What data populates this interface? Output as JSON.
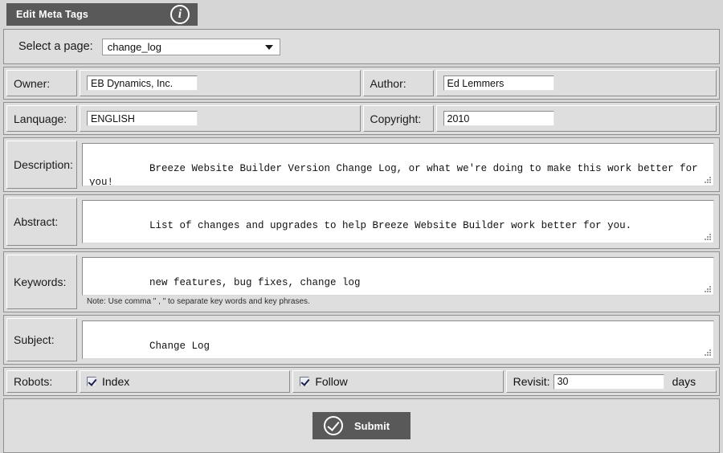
{
  "window": {
    "title": "Edit Meta Tags",
    "info_icon": "info-circle-icon"
  },
  "page_select": {
    "label": "Select a page:",
    "value": "change_log",
    "options": [
      "change_log"
    ]
  },
  "fields": {
    "owner": {
      "label": "Owner:",
      "value": "EB Dynamics, Inc."
    },
    "author": {
      "label": "Author:",
      "value": "Ed Lemmers"
    },
    "language": {
      "label": "Lanquage:",
      "value": "ENGLISH"
    },
    "copyright": {
      "label": "Copyright:",
      "value": "2010"
    },
    "description": {
      "label": "Description:",
      "value": "Breeze Website Builder Version Change Log, or what we're doing to make this work better for you!"
    },
    "abstract": {
      "label": "Abstract:",
      "value": "List of changes and upgrades to help Breeze Website Builder work better for you."
    },
    "keywords": {
      "label": "Keywords:",
      "value": "new features, bug fixes, change log",
      "note": "Note: Use comma \" , \" to separate key words and key phrases."
    },
    "subject": {
      "label": "Subject:",
      "value": "Change Log"
    }
  },
  "robots": {
    "label": "Robots:",
    "index": {
      "label": "Index",
      "checked": true
    },
    "follow": {
      "label": "Follow",
      "checked": true
    },
    "revisit": {
      "label": "Revisit:",
      "value": "30",
      "unit": "days"
    }
  },
  "submit": {
    "label": "Submit",
    "icon": "check-circle-icon"
  },
  "colors": {
    "header_bar": "#595959",
    "panel_bg": "#dedede",
    "page_bg": "#d6d6d6",
    "panel_border": "#8f8f8f",
    "field_bg": "#ffffff"
  }
}
